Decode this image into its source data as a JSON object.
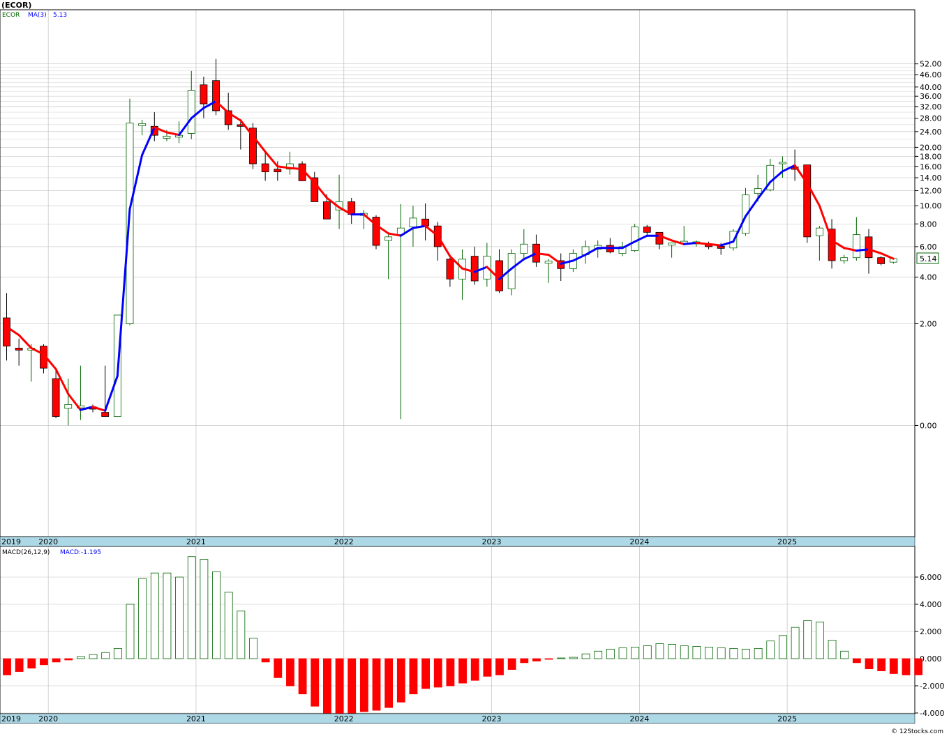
{
  "title": "(ECOR)",
  "watermark": "© 12Stocks.com",
  "price_panel": {
    "symbol": "ECOR",
    "ma_label": "MA(3)",
    "ma_value": "5.13",
    "last_price": "5.14",
    "y_ticks": [
      "52.00",
      "46.00",
      "40.00",
      "36.00",
      "32.00",
      "28.00",
      "24.00",
      "20.00",
      "18.00",
      "16.00",
      "14.00",
      "12.00",
      "10.00",
      "8.00",
      "6.00",
      "4.00",
      "2.00",
      "0.00"
    ]
  },
  "macd_panel": {
    "label": "MACD(26,12,9)",
    "value_label": "MACD:-1.195",
    "y_ticks": [
      "6.000",
      "4.000",
      "2.000",
      "0.000",
      "-2.000",
      "-4.000"
    ]
  },
  "x_axis": {
    "year_labels": [
      "2019",
      "2020",
      "2021",
      "2022",
      "2023",
      "2024",
      "2025"
    ]
  },
  "colors": {
    "up_candle": "#006400",
    "down_candle": "#ff0000",
    "ma_up": "#0000ff",
    "ma_down": "#ff0000",
    "date_band": "#add8e6",
    "grid": "#c0c0c0"
  },
  "chart_data": [
    {
      "type": "candlestick",
      "title": "(ECOR)",
      "scale": "logarithmic",
      "period": "monthly",
      "start": "2019-12",
      "end": "2025-10",
      "ma_period": 3,
      "ylim": [
        0,
        52
      ],
      "series": [
        {
          "name": "ECOR",
          "fields": [
            "open",
            "high",
            "low",
            "close"
          ],
          "values": [
            [
              2.2,
              3.2,
              1.01,
              1.35
            ],
            [
              1.3,
              1.55,
              0.9,
              1.25
            ],
            [
              1.25,
              1.4,
              0.6,
              1.3
            ],
            [
              1.35,
              1.4,
              0.75,
              0.85
            ],
            [
              0.65,
              0.85,
              0.08,
              0.1
            ],
            [
              0.2,
              0.65,
              0.0,
              0.25
            ],
            [
              0.22,
              0.9,
              0.06,
              0.22
            ],
            [
              0.22,
              0.25,
              0.15,
              0.19
            ],
            [
              0.15,
              0.9,
              0.12,
              0.1
            ],
            [
              0.1,
              1.4,
              0.16,
              2.3
            ],
            [
              2.0,
              35.0,
              1.95,
              26.5
            ],
            [
              26.0,
              27.5,
              23.0,
              26.0
            ],
            [
              25.5,
              30.0,
              21.5,
              23.0
            ],
            [
              22.5,
              24.5,
              21.5,
              22.5
            ],
            [
              22.5,
              27.0,
              21.0,
              23.0
            ],
            [
              23.5,
              48.0,
              22.0,
              38.5
            ],
            [
              41.0,
              45.0,
              28.0,
              33.0
            ],
            [
              43.0,
              55.0,
              29.0,
              30.5
            ],
            [
              30.5,
              37.5,
              24.5,
              26.0
            ],
            [
              26.0,
              27.0,
              19.5,
              25.5
            ],
            [
              25.0,
              26.5,
              15.5,
              16.5
            ],
            [
              16.5,
              19.0,
              13.5,
              15.0
            ],
            [
              15.5,
              17.0,
              13.5,
              15.0
            ],
            [
              15.5,
              19.0,
              14.5,
              16.5
            ],
            [
              16.5,
              17.0,
              13.5,
              13.5
            ],
            [
              14.0,
              15.0,
              10.5,
              10.5
            ],
            [
              10.5,
              11.5,
              8.5,
              8.5
            ],
            [
              9.5,
              14.5,
              7.5,
              10.5
            ],
            [
              10.5,
              11.0,
              8.0,
              9.0
            ],
            [
              9.0,
              9.5,
              7.5,
              9.0
            ],
            [
              8.7,
              8.9,
              5.8,
              6.1
            ],
            [
              6.5,
              7.1,
              3.9,
              6.8
            ],
            [
              7.0,
              10.2,
              0.07,
              7.6
            ],
            [
              7.7,
              10.0,
              6.0,
              8.6
            ],
            [
              8.5,
              10.3,
              6.5,
              7.8
            ],
            [
              7.8,
              8.2,
              5.0,
              6.0
            ],
            [
              5.1,
              5.2,
              3.5,
              3.9
            ],
            [
              3.9,
              5.8,
              2.9,
              5.1
            ],
            [
              5.3,
              6.0,
              3.6,
              3.8
            ],
            [
              3.9,
              6.3,
              3.5,
              5.3
            ],
            [
              5.0,
              5.8,
              3.2,
              3.3
            ],
            [
              3.4,
              5.8,
              3.1,
              5.5
            ],
            [
              5.5,
              7.5,
              5.0,
              6.2
            ],
            [
              6.2,
              7.0,
              4.6,
              4.9
            ],
            [
              4.9,
              5.1,
              3.7,
              4.9
            ],
            [
              5.0,
              5.5,
              3.8,
              4.5
            ],
            [
              4.5,
              5.8,
              4.3,
              5.5
            ],
            [
              5.4,
              6.5,
              4.8,
              6.0
            ],
            [
              5.8,
              6.5,
              5.2,
              6.1
            ],
            [
              6.1,
              6.7,
              5.5,
              5.6
            ],
            [
              5.5,
              6.4,
              5.3,
              6.0
            ],
            [
              5.7,
              8.0,
              5.6,
              7.7
            ],
            [
              7.7,
              7.9,
              6.8,
              7.2
            ],
            [
              7.2,
              7.2,
              5.8,
              6.2
            ],
            [
              6.2,
              6.3,
              5.2,
              6.2
            ],
            [
              6.3,
              7.8,
              6.2,
              6.4
            ],
            [
              6.3,
              6.5,
              6.0,
              6.3
            ],
            [
              6.2,
              6.4,
              5.8,
              6.0
            ],
            [
              6.0,
              6.3,
              5.4,
              5.9
            ],
            [
              5.9,
              7.5,
              5.7,
              7.3
            ],
            [
              7.1,
              12.4,
              6.9,
              11.4
            ],
            [
              11.6,
              14.5,
              10.5,
              12.3
            ],
            [
              12.1,
              17.5,
              11.9,
              16.2
            ],
            [
              16.5,
              18.0,
              14.0,
              16.8
            ],
            [
              15.7,
              19.5,
              13.5,
              15.6
            ],
            [
              16.3,
              16.3,
              6.3,
              6.8
            ],
            [
              6.9,
              7.8,
              5.0,
              7.6
            ],
            [
              7.5,
              8.5,
              4.5,
              5.0
            ],
            [
              5.0,
              5.4,
              4.8,
              5.2
            ],
            [
              5.2,
              8.7,
              5.0,
              7.0
            ],
            [
              6.8,
              7.5,
              4.2,
              5.2
            ],
            [
              5.2,
              5.3,
              4.7,
              4.8
            ],
            [
              4.9,
              5.2,
              4.8,
              5.14
            ]
          ]
        },
        {
          "name": "MA(3)",
          "values": [
            1.9,
            1.65,
            1.3,
            1.15,
            0.83,
            0.4,
            0.18,
            0.22,
            0.17,
            0.7,
            9.6,
            18.3,
            25.2,
            23.8,
            23.1,
            28.0,
            31.5,
            34.0,
            29.8,
            27.3,
            22.8,
            19.0,
            16.0,
            15.7,
            15.5,
            13.2,
            11.0,
            9.8,
            9.0,
            9.0,
            7.9,
            7.1,
            6.9,
            7.6,
            7.8,
            6.9,
            5.3,
            4.5,
            4.3,
            4.6,
            3.9,
            4.5,
            5.1,
            5.5,
            5.4,
            4.8,
            5.0,
            5.4,
            5.9,
            5.9,
            5.9,
            6.4,
            6.9,
            6.9,
            6.5,
            6.2,
            6.3,
            6.2,
            6.1,
            6.4,
            8.8,
            10.9,
            13.3,
            15.1,
            16.2,
            13.1,
            10.0,
            6.5,
            5.9,
            5.7,
            5.8,
            5.5,
            5.13
          ]
        }
      ]
    },
    {
      "type": "bar",
      "title": "MACD(26,12,9)",
      "ylim": [
        -4,
        7.5
      ],
      "series": [
        {
          "name": "MACD",
          "values": [
            -1.2,
            -0.95,
            -0.7,
            -0.45,
            -0.25,
            -0.1,
            0.15,
            0.3,
            0.45,
            0.75,
            4.0,
            5.9,
            6.3,
            6.3,
            6.0,
            7.5,
            7.3,
            6.4,
            4.9,
            3.5,
            1.5,
            -0.25,
            -1.4,
            -2.0,
            -2.6,
            -3.5,
            -4.0,
            -4.1,
            -4.0,
            -3.9,
            -3.8,
            -3.6,
            -3.2,
            -2.6,
            -2.2,
            -2.1,
            -2.0,
            -1.8,
            -1.6,
            -1.3,
            -1.2,
            -0.8,
            -0.3,
            -0.18,
            -0.02,
            0.05,
            0.1,
            0.35,
            0.55,
            0.7,
            0.8,
            0.85,
            0.95,
            1.1,
            1.05,
            0.95,
            0.9,
            0.85,
            0.8,
            0.75,
            0.7,
            0.75,
            1.3,
            1.7,
            2.3,
            2.8,
            2.7,
            1.35,
            0.55,
            -0.3,
            -0.75,
            -0.9,
            -1.1,
            -1.2,
            -1.195
          ]
        }
      ]
    }
  ]
}
